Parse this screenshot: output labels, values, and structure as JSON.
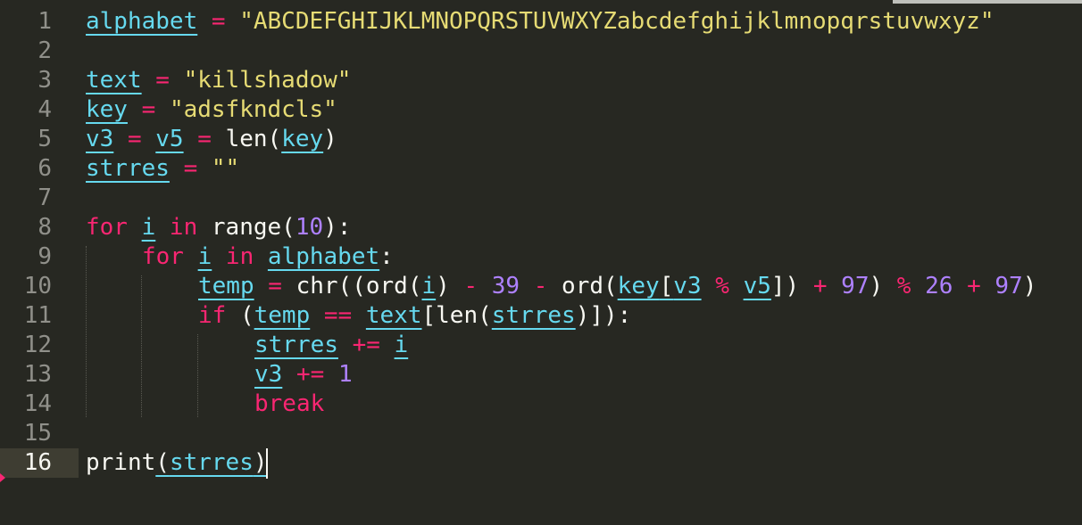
{
  "editor": {
    "active_line": 16,
    "lines": [
      {
        "n": "1"
      },
      {
        "n": "2"
      },
      {
        "n": "3"
      },
      {
        "n": "4"
      },
      {
        "n": "5"
      },
      {
        "n": "6"
      },
      {
        "n": "7"
      },
      {
        "n": "8"
      },
      {
        "n": "9"
      },
      {
        "n": "10"
      },
      {
        "n": "11"
      },
      {
        "n": "12"
      },
      {
        "n": "13"
      },
      {
        "n": "14"
      },
      {
        "n": "15"
      },
      {
        "n": "16"
      }
    ],
    "tokens": {
      "l1_alphabet": "alphabet",
      "l1_eq": " = ",
      "l1_str": "\"ABCDEFGHIJKLMNOPQRSTUVWXYZabcdefghijklmnopqrstuvwxyz\"",
      "l3_text": "text",
      "l3_eq": " = ",
      "l3_str": "\"killshadow\"",
      "l4_key": "key",
      "l4_eq": " = ",
      "l4_str": "\"adsfkndcls\"",
      "l5_v3": "v3",
      "l5_eq1": " = ",
      "l5_v5": "v5",
      "l5_eq2": " = ",
      "l5_len": "len(",
      "l5_key": "key",
      "l5_close": ")",
      "l6_strres": "strres",
      "l6_eq": " = ",
      "l6_str": "\"\"",
      "l8_for": "for",
      "l8_sp": " ",
      "l8_i": "i",
      "l8_in": " in ",
      "l8_range": "range(",
      "l8_num": "10",
      "l8_end": "):",
      "l9_for": "for",
      "l9_sp": " ",
      "l9_i": "i",
      "l9_in": " in ",
      "l9_alphabet": "alphabet",
      "l9_colon": ":",
      "l10_temp": "temp",
      "l10_eq": " = ",
      "l10_chr": "chr((ord(",
      "l10_i": "i",
      "l10_p1": ") ",
      "l10_minus1": "-",
      "l10_sp1": " ",
      "l10_39": "39",
      "l10_sp2": " ",
      "l10_minus2": "-",
      "l10_ord": " ord(",
      "l10_key": "key",
      "l10_br": "[",
      "l10_v3": "v3",
      "l10_sp3": " ",
      "l10_mod1": "%",
      "l10_sp4": " ",
      "l10_v5": "v5",
      "l10_p2": "]) ",
      "l10_plus1": "+",
      "l10_sp5": " ",
      "l10_97a": "97",
      "l10_p3": ") ",
      "l10_mod2": "%",
      "l10_sp6": " ",
      "l10_26": "26",
      "l10_sp7": " ",
      "l10_plus2": "+",
      "l10_sp8": " ",
      "l10_97b": "97",
      "l10_p4": ")",
      "l11_if": "if",
      "l11_paren": " (",
      "l11_temp": "temp",
      "l11_sp1": " ",
      "l11_eqeq": "==",
      "l11_sp2": " ",
      "l11_text": "text",
      "l11_br": "[len(",
      "l11_strres": "strres",
      "l11_end": ")]):",
      "l12_strres": "strres",
      "l12_sp1": " ",
      "l12_pluseq": "+=",
      "l12_sp2": " ",
      "l12_i": "i",
      "l13_v3": "v3",
      "l13_sp1": " ",
      "l13_pluseq": "+=",
      "l13_sp2": " ",
      "l13_1": "1",
      "l14_break": "break",
      "l16_print": "print",
      "l16_open": "(",
      "l16_strres": "strres",
      "l16_close": ")"
    }
  }
}
